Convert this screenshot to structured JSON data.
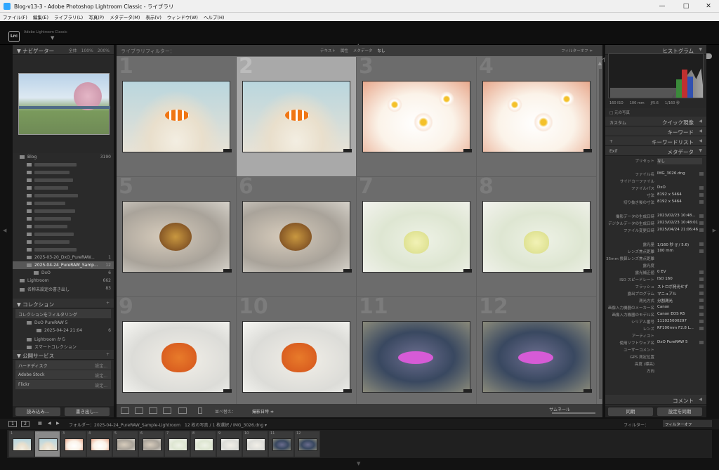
{
  "window": {
    "title": "Blog-v13-3 - Adobe Photoshop Lightroom Classic - ライブラリ",
    "min": "—",
    "max": "□",
    "close": "✕"
  },
  "menu": [
    "ファイル(F)",
    "編集(E)",
    "ライブラリ(L)",
    "写真(P)",
    "メタデータ(M)",
    "表示(V)",
    "ウィンドウ(W)",
    "ヘルプ(H)"
  ],
  "identity": {
    "logo": "Lrc",
    "subtitle": "Adobe Lightroom Classic"
  },
  "modules": [
    {
      "label": "ライブラリ",
      "active": true
    },
    {
      "label": "現像",
      "active": false
    },
    {
      "label": "マップ",
      "active": false
    },
    {
      "label": "ブック",
      "active": false
    },
    {
      "label": "スライドショー",
      "active": false
    },
    {
      "label": "プリント",
      "active": false
    },
    {
      "label": "Web",
      "active": false
    }
  ],
  "left": {
    "navigator": {
      "title": "ナビゲーター",
      "fit": "全体",
      "z1": "100%",
      "z2": "200%"
    },
    "folders": [
      {
        "label": "Blog",
        "count": "3190",
        "level": 0,
        "blur": false
      },
      {
        "label": "",
        "count": "",
        "level": 1,
        "blur": true,
        "w": 60
      },
      {
        "label": "",
        "count": "",
        "level": 1,
        "blur": true,
        "w": 50
      },
      {
        "label": "",
        "count": "",
        "level": 1,
        "blur": true,
        "w": 55
      },
      {
        "label": "",
        "count": "",
        "level": 1,
        "blur": true,
        "w": 48
      },
      {
        "label": "",
        "count": "",
        "level": 1,
        "blur": true,
        "w": 62
      },
      {
        "label": "",
        "count": "",
        "level": 1,
        "blur": true,
        "w": 44
      },
      {
        "label": "",
        "count": "",
        "level": 1,
        "blur": true,
        "w": 58
      },
      {
        "label": "",
        "count": "",
        "level": 1,
        "blur": true,
        "w": 52
      },
      {
        "label": "",
        "count": "",
        "level": 1,
        "blur": true,
        "w": 47
      },
      {
        "label": "",
        "count": "",
        "level": 1,
        "blur": true,
        "w": 56
      },
      {
        "label": "",
        "count": "",
        "level": 1,
        "blur": true,
        "w": 50
      },
      {
        "label": "",
        "count": "",
        "level": 1,
        "blur": true,
        "w": 60
      },
      {
        "label": "2025-03-20_DxO_PureRAW...",
        "count": "1",
        "level": 1,
        "blur": false
      },
      {
        "label": "2025-04-24_PureRAW_Samp...",
        "count": "12",
        "level": 1,
        "blur": false,
        "sel": true
      },
      {
        "label": "DxO",
        "count": "6",
        "level": 2,
        "blur": false
      },
      {
        "label": "Lightroom",
        "count": "662",
        "level": 0,
        "blur": false
      },
      {
        "label": "名称未設定の書き出し",
        "count": "83",
        "level": 0,
        "blur": false
      }
    ],
    "collections": {
      "title": "コレクション",
      "filter": "コレクションをフィルタリング",
      "items": [
        {
          "label": "DxO PureRAW 5",
          "count": ""
        },
        {
          "label": "2025-04-24 21:04",
          "count": "6"
        },
        {
          "label": "Lightroom から",
          "count": ""
        },
        {
          "label": "スマートコレクション",
          "count": ""
        }
      ]
    },
    "publish": {
      "title": "公開サービス",
      "items": [
        {
          "label": "ハードディスク",
          "btn": "設定..."
        },
        {
          "label": "Adobe Stock",
          "btn": "設定..."
        },
        {
          "label": "Flickr",
          "btn": "設定..."
        }
      ]
    },
    "import": "読み込み...",
    "export": "書き出し..."
  },
  "filterbar": {
    "title": "ライブラリフィルター：",
    "opts": [
      "テキスト",
      "属性",
      "メタデータ",
      "なし"
    ],
    "off": "フィルターオフ ≑"
  },
  "grid": [
    {
      "n": "1",
      "kind": "clown"
    },
    {
      "n": "2",
      "kind": "clown",
      "sel": true
    },
    {
      "n": "3",
      "kind": "white"
    },
    {
      "n": "4",
      "kind": "white"
    },
    {
      "n": "5",
      "kind": "sand"
    },
    {
      "n": "6",
      "kind": "sand"
    },
    {
      "n": "7",
      "kind": "pale"
    },
    {
      "n": "8",
      "kind": "pale"
    },
    {
      "n": "9",
      "kind": "snow"
    },
    {
      "n": "10",
      "kind": "snow"
    },
    {
      "n": "11",
      "kind": "blue"
    },
    {
      "n": "12",
      "kind": "blue"
    }
  ],
  "toolbar": {
    "sort_label": "並べ替え：",
    "sort_value": "撮影日時 ≑",
    "thumbs": "サムネール"
  },
  "right": {
    "histogram": "ヒストグラム",
    "hist_info": [
      "160 ISO",
      "100 mm",
      "ƒ/5.6",
      "1/160 秒"
    ],
    "original": "元の写真",
    "quick_preset": "カスタム",
    "quick": "クイック現像",
    "keywording": "キーワード",
    "keyword_list": "キーワードリスト",
    "metadata_preset": "Exif",
    "metadata": "メタデータ",
    "preset_label": "プリセット",
    "preset_value": "なし",
    "fields": [
      [
        "ファイル名",
        "IMG_3026.dng"
      ],
      [
        "サイドカーファイル",
        ""
      ],
      [
        "ファイルパス",
        "DxO"
      ],
      [
        "寸法",
        "8192 x 5464"
      ],
      [
        "切り抜き後の寸法",
        "8192 x 5464"
      ],
      [
        "",
        ""
      ],
      [
        "撮影データの生成日時",
        "2023/02/23 10:48..."
      ],
      [
        "デジタルデータの生成日時",
        "2023/02/23 10:48:01"
      ],
      [
        "ファイル変更日時",
        "2025/04/24 21:06:46"
      ],
      [
        "",
        ""
      ],
      [
        "露光量",
        "1/160 秒 (ƒ / 5.6)"
      ],
      [
        "レンズ焦点距離",
        "100 mm"
      ],
      [
        "35mm 換算レンズ焦点距離",
        ""
      ],
      [
        "露光度",
        ""
      ],
      [
        "露光補正値",
        "0 EV"
      ],
      [
        "ISO スピードレート",
        "ISO 160"
      ],
      [
        "フラッシュ",
        "ストロボ発光せず"
      ],
      [
        "露出プログラム",
        "マニュアル"
      ],
      [
        "測光方式",
        "分割測光"
      ],
      [
        "画像入力機器のメーカー名",
        "Canon"
      ],
      [
        "画像入力機器のモデル名",
        "Canon EOS R5"
      ],
      [
        "シリアル番号",
        "111025000297"
      ],
      [
        "レンズ",
        "RF100mm F2.8 L..."
      ],
      [
        "アーティスト",
        ""
      ],
      [
        "使用ソフトウェア名",
        "DxO PureRAW 5"
      ],
      [
        "ユーザーコメント",
        ""
      ],
      [
        "GPS 測定位置",
        ""
      ],
      [
        "高度 (標高)",
        ""
      ],
      [
        "方向",
        ""
      ]
    ],
    "comments": "コメント",
    "sync": "同期",
    "sync_settings": "設定を同期"
  },
  "filmstrip": {
    "path": "フォルダー：2025-04-24_PureRAW_Sample-Lightroom　12 枚の写真 / 1 枚選択 / IMG_3026.dng ▾",
    "filter_label": "フィルター：",
    "filter_value": "フィルターオフ",
    "b1": "1",
    "b2": "2"
  }
}
